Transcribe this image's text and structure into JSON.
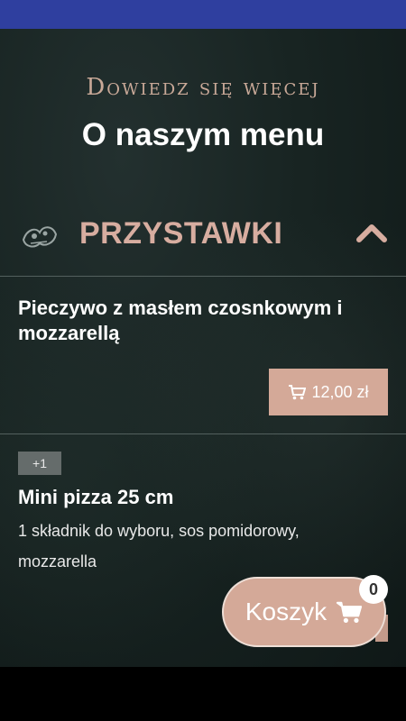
{
  "header": {
    "subtitle": "Dowiedz się więcej",
    "title": "O naszym menu"
  },
  "category": {
    "label": "PRZYSTAWKI",
    "icon": "food-illustration-icon",
    "expanded": true
  },
  "items": [
    {
      "name": "Pieczywo z masłem czosnkowym i mozzarellą",
      "price": "12,00 zł"
    },
    {
      "badge": "+1",
      "name": "Mini pizza 25 cm",
      "description": "1 składnik do wyboru, sos pomidorowy, mozzarella"
    }
  ],
  "cart": {
    "label": "Koszyk",
    "count": "0"
  },
  "colors": {
    "accent": "#d4a998",
    "status_bar": "#2f3f9f",
    "background": "#182422"
  }
}
